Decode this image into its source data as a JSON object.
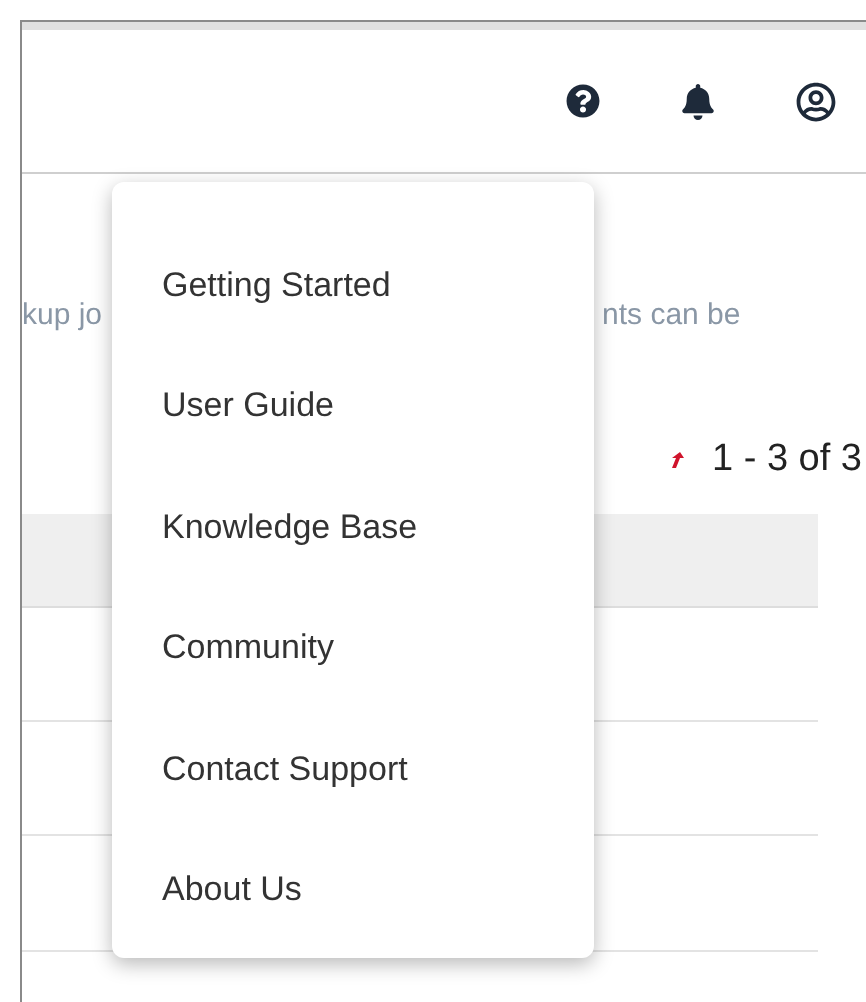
{
  "header": {
    "icons": [
      {
        "kind": "help"
      },
      {
        "kind": "notifications"
      },
      {
        "kind": "account"
      }
    ]
  },
  "description_fragments": [
    "kup jo",
    "nts can be"
  ],
  "pagination": {
    "range": "1 - 3 of 3"
  },
  "help_menu": {
    "items": [
      {
        "label": "Getting Started"
      },
      {
        "label": "User Guide"
      },
      {
        "label": "Knowledge Base"
      },
      {
        "label": "Community"
      },
      {
        "label": "Contact Support"
      },
      {
        "label": "About Us"
      }
    ]
  }
}
